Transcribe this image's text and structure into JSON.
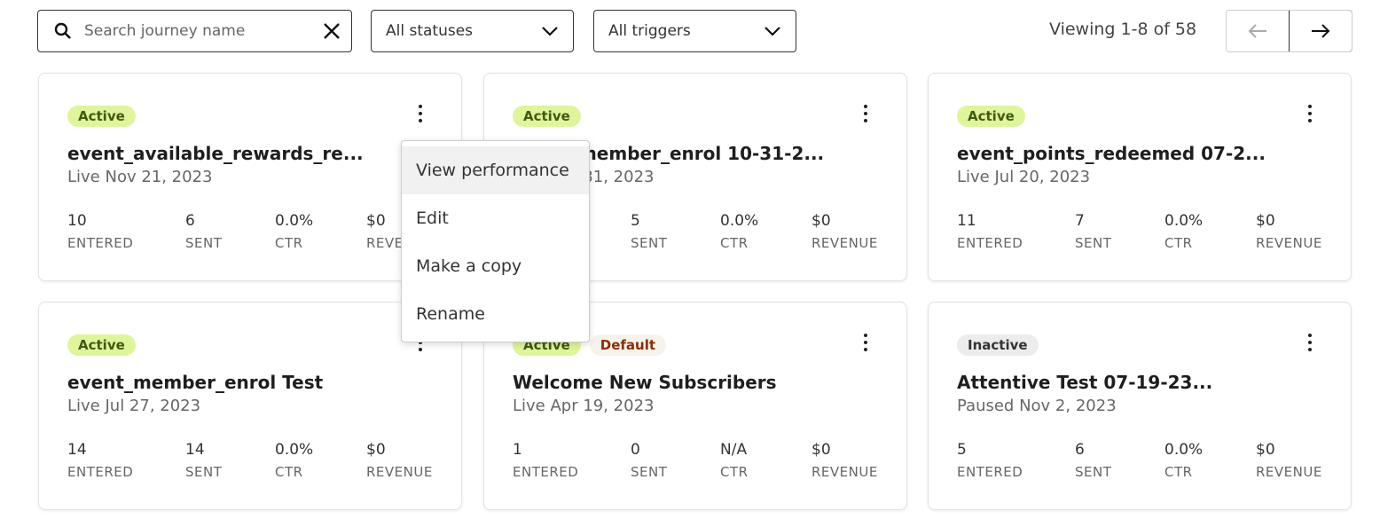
{
  "toolbar": {
    "search_placeholder": "Search journey name",
    "status_filter": "All statuses",
    "trigger_filter": "All triggers",
    "viewing": "Viewing 1-8 of 58"
  },
  "menu": {
    "items": [
      "View performance",
      "Edit",
      "Make a copy",
      "Rename"
    ]
  },
  "stat_labels": [
    "ENTERED",
    "SENT",
    "CTR",
    "REVENUE"
  ],
  "cards": [
    {
      "badges": [
        "Active"
      ],
      "title": "event_available_rewards_re...",
      "date": "Live Nov 21, 2023",
      "stats": [
        "10",
        "6",
        "0.0%",
        "$0"
      ]
    },
    {
      "badges": [
        "Active"
      ],
      "title": "event_member_enrol 10-31-2...",
      "date": "Live Oct 31, 2023",
      "stats": [
        "",
        "5",
        "0.0%",
        "$0"
      ]
    },
    {
      "badges": [
        "Active"
      ],
      "title": "event_points_redeemed 07-2...",
      "date": "Live Jul 20, 2023",
      "stats": [
        "11",
        "7",
        "0.0%",
        "$0"
      ]
    },
    {
      "badges": [
        "Active"
      ],
      "title": "event_member_enrol Test",
      "date": "Live Jul 27, 2023",
      "stats": [
        "14",
        "14",
        "0.0%",
        "$0"
      ]
    },
    {
      "badges": [
        "Active",
        "Default"
      ],
      "title": "Welcome New Subscribers",
      "date": "Live Apr 19, 2023",
      "stats": [
        "1",
        "0",
        "N/A",
        "$0"
      ]
    },
    {
      "badges": [
        "Inactive"
      ],
      "title": "Attentive Test 07-19-23...",
      "date": "Paused Nov 2, 2023",
      "stats": [
        "5",
        "6",
        "0.0%",
        "$0"
      ]
    }
  ],
  "colors": {
    "active_bg": "#dff59b",
    "active_text": "#3f5a12",
    "default_bg": "#f7f3ec",
    "default_text": "#8a2e08",
    "inactive_bg": "#ececec"
  }
}
